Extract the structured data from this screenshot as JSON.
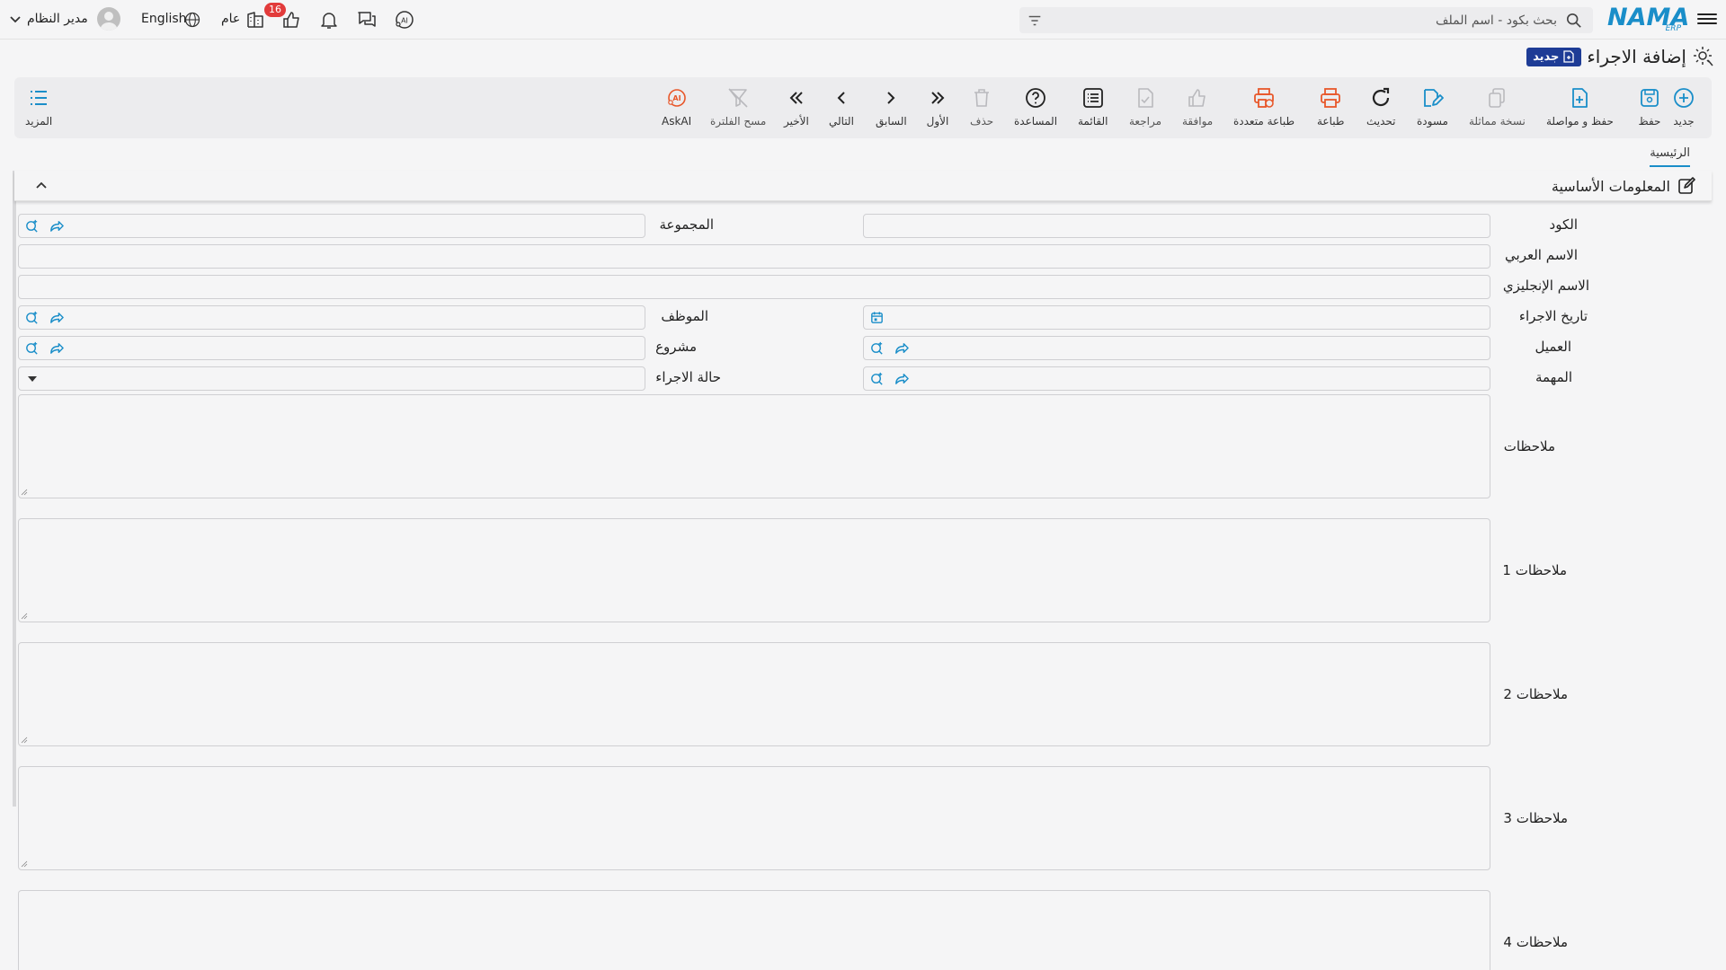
{
  "header": {
    "logo_text": "NAMA",
    "logo_sub": "ERP",
    "search_placeholder": "بحث بكود - اسم الملف",
    "notifications_count": "16",
    "branch_label": "عام",
    "language_label": "English",
    "user_name": "مدير النظام"
  },
  "page": {
    "title": "إضافة الاجراء",
    "status_badge": "جديد"
  },
  "toolbar": {
    "new": "جديد",
    "save": "حفظ",
    "save_continue": "حفظ و مواصلة",
    "copy_similar": "نسخة مماثلة",
    "draft": "مسودة",
    "refresh": "تحديث",
    "print": "طباعة",
    "multi_print": "طباعة متعددة",
    "approve": "موافقة",
    "review": "مراجعة",
    "list": "القائمة",
    "help": "المساعدة",
    "delete": "حذف",
    "first": "الأول",
    "previous": "السابق",
    "next": "التالي",
    "last": "الأخير",
    "clear_filter": "مسح الفلترة",
    "ask_ai": "AskAI",
    "more": "المزيد"
  },
  "tabs": {
    "main": "الرئيسية"
  },
  "section": {
    "title": "المعلومات الأساسية"
  },
  "form": {
    "code": "الكود",
    "group": "المجموعة",
    "arabic_name": "الاسم العربي",
    "english_name": "الاسم الإنجليزي",
    "action_date": "تاريخ الاجراء",
    "employee": "الموظف",
    "customer": "العميل",
    "project": "مشروع",
    "task": "المهمة",
    "action_status": "حالة الاجراء",
    "notes": "ملاحظات",
    "notes1": "ملاحظات 1",
    "notes2": "ملاحظات 2",
    "notes3": "ملاحظات 3",
    "notes4": "ملاحظات 4"
  },
  "colors": {
    "accent": "#1a8ec9",
    "badge_red": "#e23b3b",
    "new_badge": "#1e3c96",
    "print_orange": "#e8572a"
  }
}
